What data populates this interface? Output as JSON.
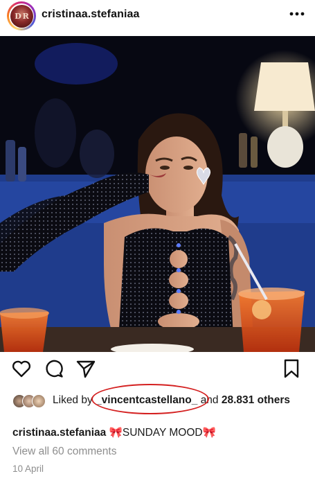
{
  "post": {
    "avatar_initials": "D R",
    "username": "cristinaa.stefaniaa",
    "more_icon": "ellipsis-icon"
  },
  "actions": {
    "like_icon": "heart-icon",
    "comment_icon": "comment-icon",
    "share_icon": "send-icon",
    "save_icon": "bookmark-icon"
  },
  "likes": {
    "prefix": "Liked by",
    "highlighted_user": "_vincentcastellano_",
    "middle": "and",
    "count": "28.831",
    "suffix": "others"
  },
  "caption": {
    "username": "cristinaa.stefaniaa",
    "emoji_before": "🎀",
    "text": "SUNDAY MOOD",
    "emoji_after": "🎀"
  },
  "comments_link": "View all 60 comments",
  "date": "10 April",
  "colors": {
    "highlight_ring": "#d42020",
    "secondary_text": "#8e8e8e"
  }
}
